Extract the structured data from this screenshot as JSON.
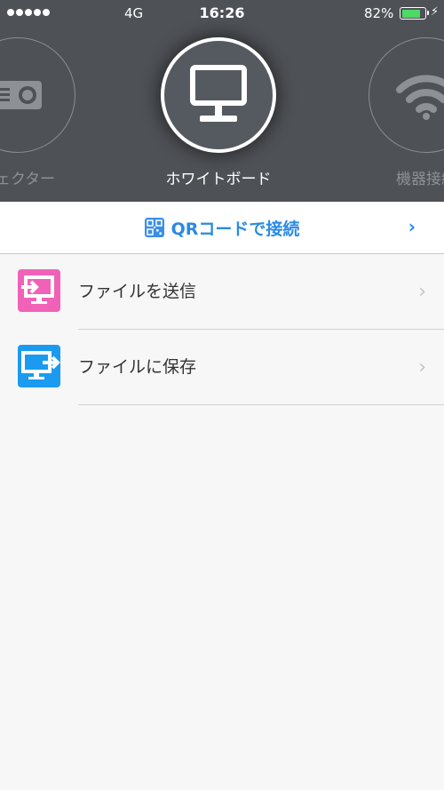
{
  "status_bar": {
    "carrier": "4G",
    "time": "16:26",
    "battery_percent": "82%",
    "battery_level": 0.82,
    "signal_bars": 5
  },
  "carousel": {
    "items": [
      {
        "label": "ジェクター",
        "icon": "projector-icon",
        "state": "inactive"
      },
      {
        "label": "ホワイトボード",
        "icon": "whiteboard-monitor-icon",
        "state": "selected"
      },
      {
        "label": "機器接続",
        "icon": "wifi-icon",
        "state": "inactive"
      }
    ]
  },
  "qr_bar": {
    "label": "QRコードで接続",
    "icon": "qr-code-icon",
    "accent_color": "#2a8ae3"
  },
  "menu": {
    "items": [
      {
        "label": "ファイルを送信",
        "icon": "send-file-icon",
        "color": "#f062b8"
      },
      {
        "label": "ファイルに保存",
        "icon": "save-file-icon",
        "color": "#1a9bf0"
      }
    ]
  },
  "colors": {
    "header_bg": "#4e5156",
    "page_bg": "#f7f7f7"
  }
}
